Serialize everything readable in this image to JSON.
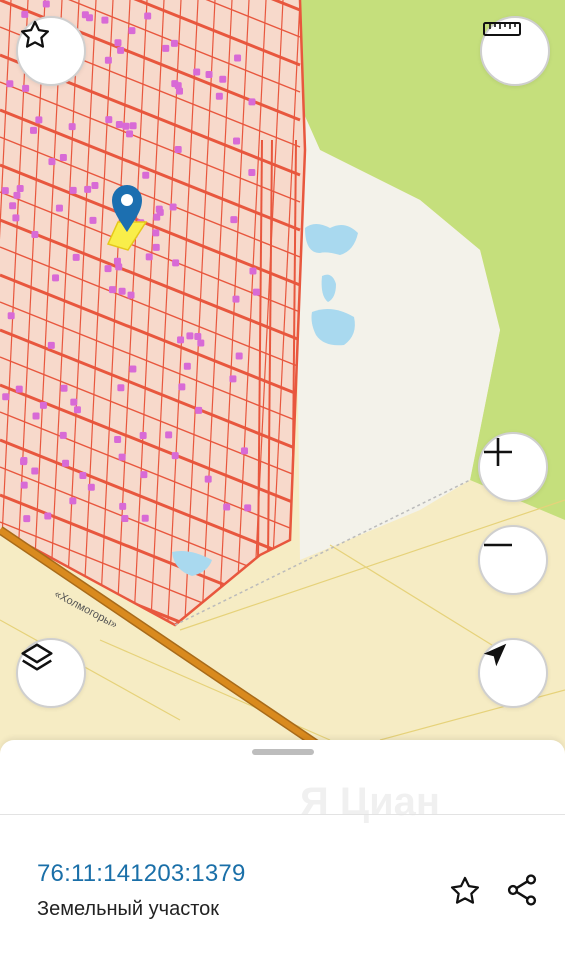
{
  "map": {
    "road_label": "«Холмогоры»",
    "colors": {
      "forest": "#c5df7c",
      "field": "#f6ecc4",
      "settlement": "#f7d9cb",
      "parcel_lines": "#e8573e",
      "buildings": "#d86ad6",
      "water": "#a9d9ef",
      "road": "#d98a1e",
      "selected_parcel": "#f9ee4a",
      "pin": "#1c6fb0"
    },
    "buttons": {
      "favorite_icon": "star-outline-icon",
      "ruler_icon": "ruler-icon",
      "zoom_in_icon": "plus-icon",
      "zoom_out_icon": "minus-icon",
      "layers_icon": "layers-icon",
      "locate_icon": "navigation-arrow-icon"
    }
  },
  "sheet": {
    "parcel_id": "76:11:141203:1379",
    "parcel_type": "Земельный участок",
    "watermark": "Я Циан",
    "favorite_icon": "star-outline-icon",
    "share_icon": "share-icon"
  }
}
